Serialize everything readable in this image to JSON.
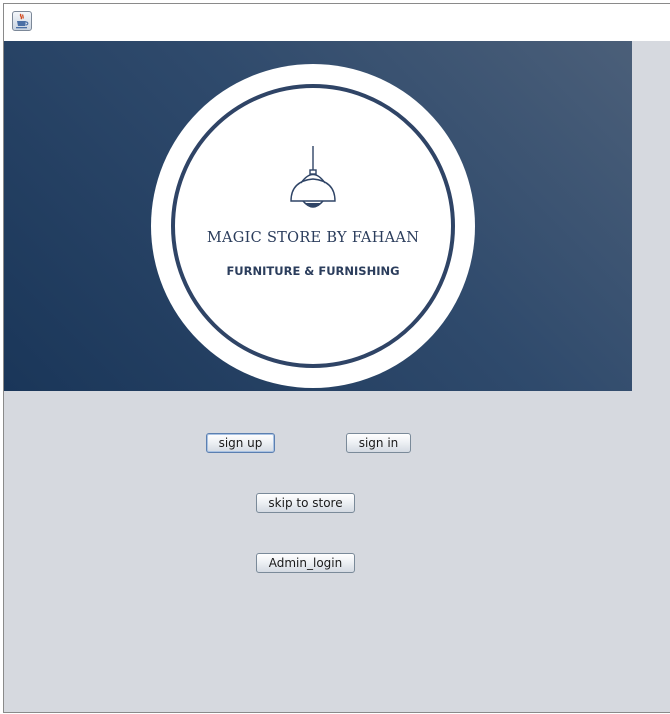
{
  "window": {
    "icon": "java-coffee-cup-icon"
  },
  "banner": {
    "logo_title": "MAGIC STORE BY FAHAAN",
    "logo_subtitle": "FURNITURE & FURNISHING",
    "logo_icon": "pendant-lamp-icon",
    "colors": {
      "gradient_dark": "#1a3659",
      "gradient_light": "#4b5f79",
      "logo_ink": "#2b3d5c"
    }
  },
  "buttons": {
    "sign_up": "sign up",
    "sign_in": "sign in",
    "skip_to_store": "skip to store",
    "admin_login": "Admin_login"
  }
}
